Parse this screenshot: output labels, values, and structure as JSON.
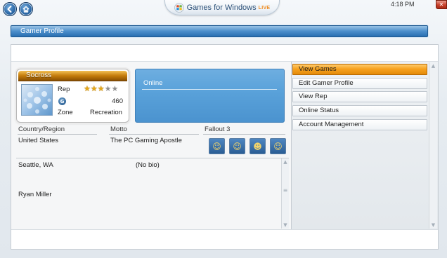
{
  "top_bar": {
    "brand": "Games for Windows",
    "brand_suffix": "LIVE",
    "clock": "4:18 PM",
    "close_glyph": "✕",
    "back_icon": "back-arrow-icon",
    "home_icon": "home-icon"
  },
  "page": {
    "title": "Gamer Profile"
  },
  "gamercard": {
    "gamertag": "Socross",
    "rep_label": "Rep",
    "rep_stars": 3,
    "rep_max": 5,
    "gamerscore_glyph": "G",
    "gamerscore": "460",
    "zone_label": "Zone",
    "zone": "Recreation"
  },
  "status": {
    "online": "Online"
  },
  "profile": {
    "country_header": "Country/Region",
    "country": "United States",
    "motto_header": "Motto",
    "motto": "The PC Gaming Apostle",
    "game_header": "Fallout 3",
    "location": "Seattle, WA",
    "bio": "(No bio)",
    "name": "Ryan Miller",
    "game_icons": [
      "vault-boy-thumbs-up-icon",
      "vault-boy-portrait-icon",
      "vault-boy-gun-icon",
      "vault-boy-map-icon"
    ]
  },
  "menu": {
    "items": [
      {
        "label": "View Games",
        "selected": true
      },
      {
        "label": "Edit Gamer Profile",
        "selected": false
      },
      {
        "label": "View Rep",
        "selected": false
      },
      {
        "label": "Online Status",
        "selected": false
      },
      {
        "label": "Account Management",
        "selected": false
      }
    ]
  },
  "colors": {
    "title_bar": "#2a6fb1",
    "selected_menu": "#f7a21f",
    "online_box": "#5aa2da",
    "gamertag_banner": "#c47c0c"
  }
}
